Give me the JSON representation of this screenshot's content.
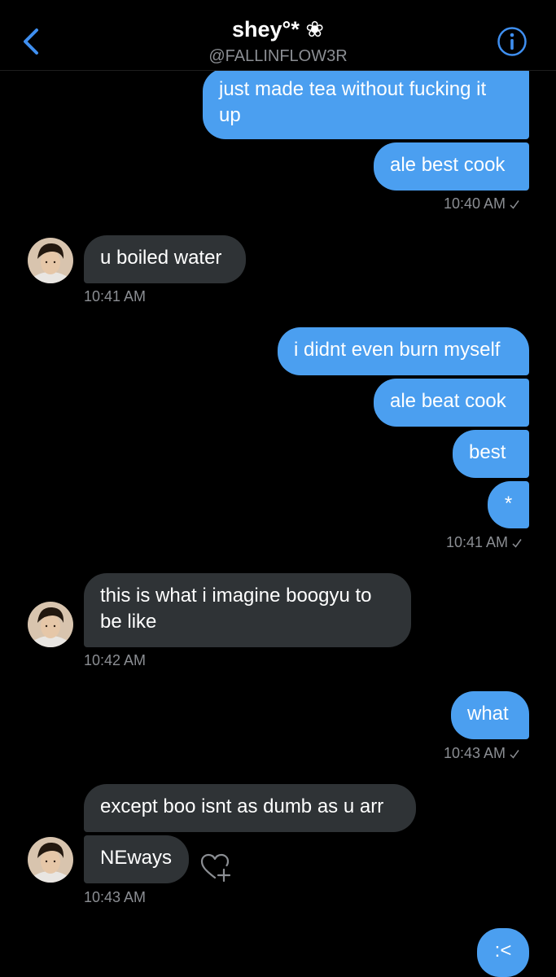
{
  "header": {
    "name": "shey°* ❀",
    "handle": "@FALLINFLOW3R"
  },
  "messages": [
    {
      "sender": "me",
      "text": "just made tea without fucking it up"
    },
    {
      "sender": "me",
      "text": "ale best cook"
    },
    {
      "sender": "them",
      "text": "u boiled water"
    },
    {
      "sender": "me",
      "text": "i didnt even burn myself"
    },
    {
      "sender": "me",
      "text": "ale beat cook"
    },
    {
      "sender": "me",
      "text": "best"
    },
    {
      "sender": "me",
      "text": "*"
    },
    {
      "sender": "them",
      "text": "this is what i imagine boogyu to be like"
    },
    {
      "sender": "me",
      "text": "what"
    },
    {
      "sender": "them",
      "text": "except boo isnt as dumb as u arr"
    },
    {
      "sender": "them",
      "text": "NEways"
    },
    {
      "sender": "me",
      "text": ":<"
    }
  ],
  "timestamps": [
    {
      "text": "10:40 AM",
      "read": true
    },
    {
      "text": "10:41 AM",
      "read": false
    },
    {
      "text": "10:41 AM",
      "read": true
    },
    {
      "text": "10:42 AM",
      "read": false
    },
    {
      "text": "10:43 AM",
      "read": true
    },
    {
      "text": "10:43 AM",
      "read": false
    }
  ],
  "colors": {
    "outgoing_bubble": "#4b9ff0",
    "incoming_bubble": "#2f3336",
    "accent": "#3f8ff0",
    "meta_text": "#8b8e93"
  },
  "icons": [
    "back-icon",
    "info-icon",
    "checkmark-icon",
    "heart-plus-icon"
  ]
}
